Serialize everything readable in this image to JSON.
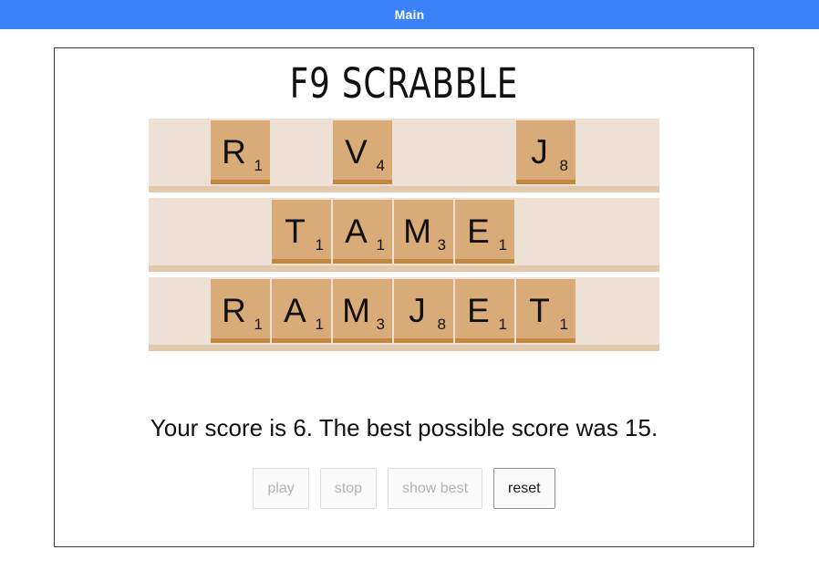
{
  "window": {
    "title": "Main",
    "titlebar_color": "#3b82f6"
  },
  "app": {
    "heading": "F9 SCRABBLE"
  },
  "board": {
    "rack_slots": 8,
    "tile_color": "#d9ab78",
    "tile_edge_color": "#c1883f",
    "rack_color": "#ede0d4",
    "rack_edge_color": "#e3c9ae",
    "rows": [
      {
        "word": "R V J",
        "slots": [
          {
            "letter": "",
            "points": ""
          },
          {
            "letter": "R",
            "points": "1"
          },
          {
            "letter": "",
            "points": ""
          },
          {
            "letter": "V",
            "points": "4"
          },
          {
            "letter": "",
            "points": ""
          },
          {
            "letter": "",
            "points": ""
          },
          {
            "letter": "J",
            "points": "8"
          },
          {
            "letter": "",
            "points": ""
          }
        ]
      },
      {
        "word": "TAME",
        "slots": [
          {
            "letter": "",
            "points": ""
          },
          {
            "letter": "",
            "points": ""
          },
          {
            "letter": "T",
            "points": "1"
          },
          {
            "letter": "A",
            "points": "1"
          },
          {
            "letter": "M",
            "points": "3"
          },
          {
            "letter": "E",
            "points": "1"
          },
          {
            "letter": "",
            "points": ""
          },
          {
            "letter": "",
            "points": ""
          }
        ]
      },
      {
        "word": "RAMJET",
        "slots": [
          {
            "letter": "",
            "points": ""
          },
          {
            "letter": "R",
            "points": "1"
          },
          {
            "letter": "A",
            "points": "1"
          },
          {
            "letter": "M",
            "points": "3"
          },
          {
            "letter": "J",
            "points": "8"
          },
          {
            "letter": "E",
            "points": "1"
          },
          {
            "letter": "T",
            "points": "1"
          },
          {
            "letter": "",
            "points": ""
          }
        ]
      }
    ]
  },
  "status": {
    "score_text": "Your score is 6. The best possible score was 15.",
    "your_score": 6,
    "best_score": 15
  },
  "controls": {
    "buttons": [
      {
        "label": "play",
        "enabled": false
      },
      {
        "label": "stop",
        "enabled": false
      },
      {
        "label": "show best",
        "enabled": false
      },
      {
        "label": "reset",
        "enabled": true
      }
    ]
  }
}
